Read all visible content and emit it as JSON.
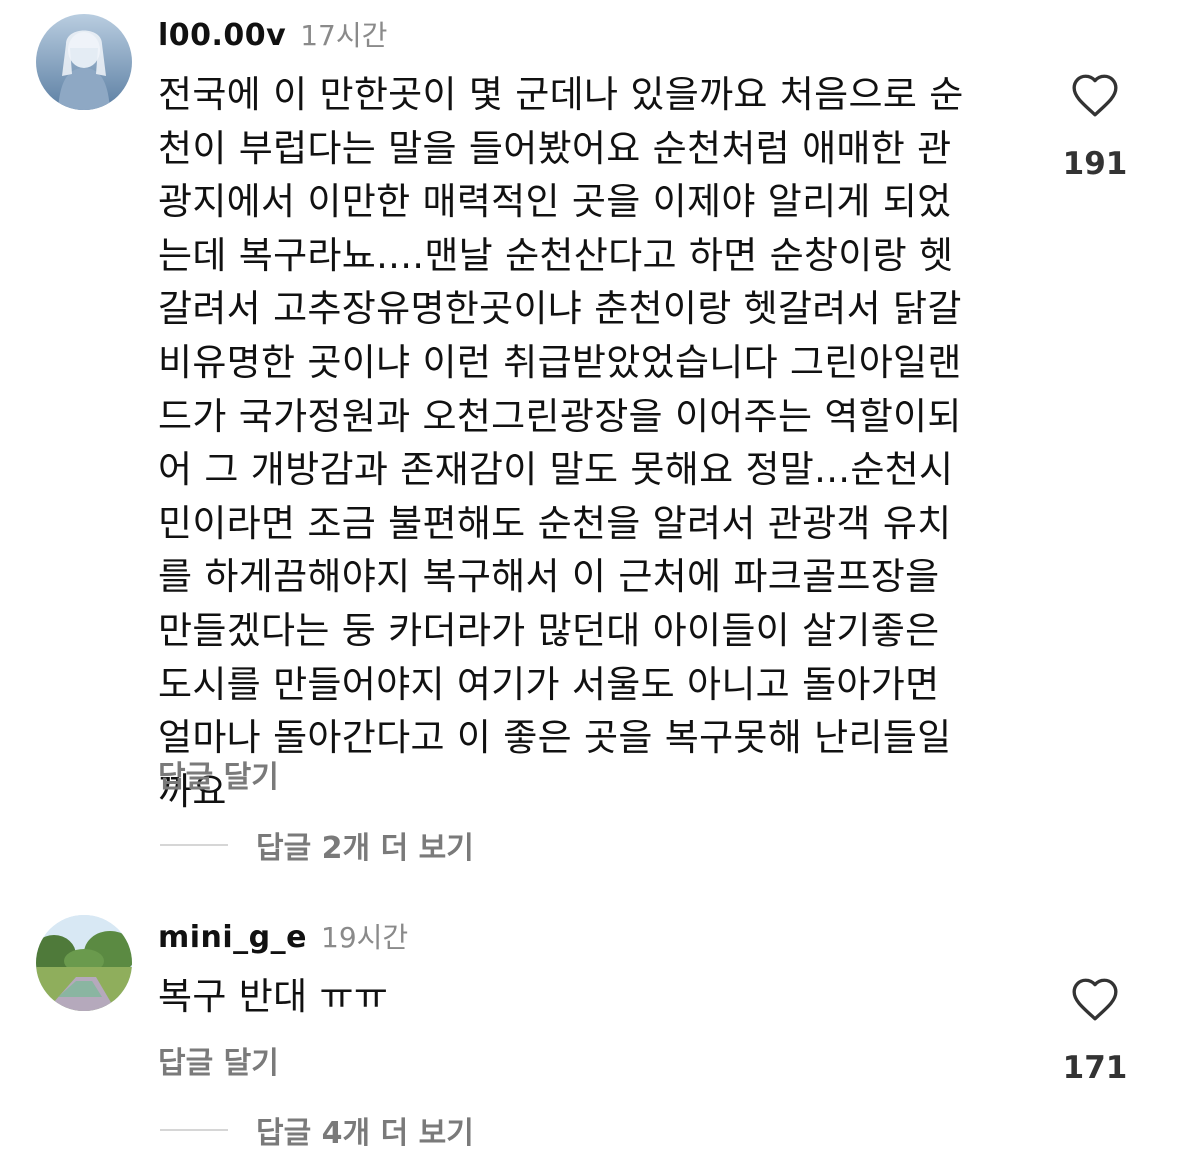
{
  "comments": [
    {
      "username": "l00.00v",
      "time": "17시간",
      "text": "전국에 이 만한곳이 몇 군데나 있을까요 처음으로 순\n천이 부럽다는 말을 들어봤어요 순천처럼 애매한 관\n광지에서 이만한 매력적인 곳을 이제야 알리게 되었\n는데 복구라뇨....맨날 순천산다고 하면 순창이랑 헷\n갈려서 고추장유명한곳이냐 춘천이랑 헷갈려서 닭갈\n비유명한 곳이냐 이런 취급받았었습니다 그린아일랜\n드가 국가정원과 오천그린광장을 이어주는 역할이되\n어 그 개방감과 존재감이 말도 못해요 정말...순천시\n민이라면 조금 불편해도 순천을 알려서 관광객 유치\n를 하게끔해야지 복구해서 이 근처에 파크골프장을\n만들겠다는 둥 카더라가 많던대 아이들이 살기좋은\n도시를 만들어야지 여기가 서울도 아니고 돌아가면\n얼마나 돌아간다고 이 좋은 곳을 복구못해 난리들일\n까요",
      "reply_label": "답글 달기",
      "view_replies": "답글 2개 더 보기",
      "likes": "191",
      "avatar_icon": "avatar-person-icon"
    },
    {
      "username": "mini_g_e",
      "time": "19시간",
      "text": "복구 반대 ㅠㅠ",
      "reply_label": "답글 달기",
      "view_replies": "답글 4개 더 보기",
      "likes": "171",
      "avatar_icon": "avatar-park-icon"
    }
  ],
  "like_icon": "heart-icon"
}
